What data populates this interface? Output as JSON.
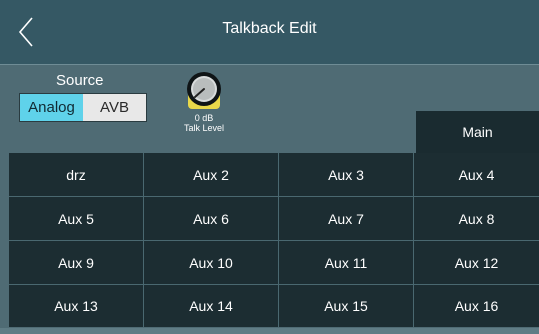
{
  "header": {
    "title": "Talkback Edit"
  },
  "source": {
    "label": "Source",
    "options": [
      "Analog",
      "AVB"
    ],
    "selected": "Analog"
  },
  "talk_level": {
    "value": "0 dB",
    "label": "Talk Level"
  },
  "main_tab": {
    "label": "Main"
  },
  "buses": [
    [
      "drz",
      "Aux 2",
      "Aux 3",
      "Aux 4"
    ],
    [
      "Aux 5",
      "Aux 6",
      "Aux 7",
      "Aux 8"
    ],
    [
      "Aux 9",
      "Aux 10",
      "Aux 11",
      "Aux 12"
    ],
    [
      "Aux 13",
      "Aux 14",
      "Aux 15",
      "Aux 16"
    ]
  ],
  "colors": {
    "header_bg": "#355864",
    "panel_bg": "#4f6b74",
    "cell_bg": "#1c2d32",
    "accent": "#5fd2ea",
    "knob_yellow": "#e9d84a"
  }
}
